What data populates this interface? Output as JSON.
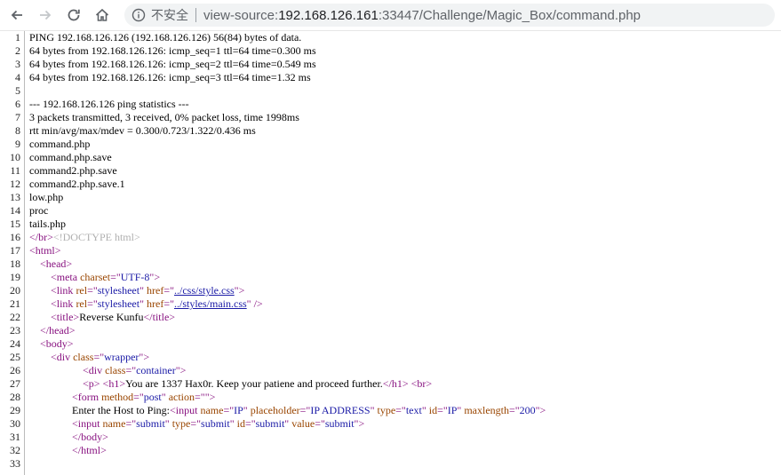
{
  "browser": {
    "security_label": "不安全",
    "url_scheme": "view-source:",
    "url_host": "192.168.126.161",
    "url_rest": ":33447/Challenge/Magic_Box/command.php"
  },
  "source_lines": [
    {
      "n": "1",
      "text": "PING 192.168.126.126 (192.168.126.126) 56(84) bytes of data."
    },
    {
      "n": "2",
      "text": "64 bytes from 192.168.126.126: icmp_seq=1 ttl=64 time=0.300 ms"
    },
    {
      "n": "3",
      "text": "64 bytes from 192.168.126.126: icmp_seq=2 ttl=64 time=0.549 ms"
    },
    {
      "n": "4",
      "text": "64 bytes from 192.168.126.126: icmp_seq=3 ttl=64 time=1.32 ms"
    },
    {
      "n": "5",
      "text": ""
    },
    {
      "n": "6",
      "text": "--- 192.168.126.126 ping statistics ---"
    },
    {
      "n": "7",
      "text": "3 packets transmitted, 3 received, 0% packet loss, time 1998ms"
    },
    {
      "n": "8",
      "text": "rtt min/avg/max/mdev = 0.300/0.723/1.322/0.436 ms"
    },
    {
      "n": "9",
      "text": "command.php"
    },
    {
      "n": "10",
      "text": "command.php.save"
    },
    {
      "n": "11",
      "text": "command2.php.save"
    },
    {
      "n": "12",
      "text": "command2.php.save.1"
    },
    {
      "n": "13",
      "text": "low.php"
    },
    {
      "n": "14",
      "text": "proc"
    },
    {
      "n": "15",
      "text": "tails.php"
    },
    {
      "n": "16",
      "a": "</br>",
      "b": "<!DOCTYPE html>"
    },
    {
      "n": "17",
      "a": "<html>"
    },
    {
      "n": "18",
      "indent": "    ",
      "a": "<head>"
    },
    {
      "n": "19",
      "indent": "        ",
      "a": "<meta ",
      "b": "charset",
      "c": "=\"",
      "d": "UTF-8",
      "e": "\">"
    },
    {
      "n": "20",
      "indent": "        ",
      "a": "<link ",
      "b": "rel",
      "c": "=\"",
      "d": "stylesheet",
      "e": "\" ",
      "f": "href",
      "g": "=\"",
      "h": "../css/style.css",
      "i": "\">"
    },
    {
      "n": "21",
      "indent": "        ",
      "a": "<link ",
      "b": "rel",
      "c": "=\"",
      "d": "stylesheet",
      "e": "\" ",
      "f": "href",
      "g": "=\"",
      "h": "../styles/main.css",
      "i": "\" />"
    },
    {
      "n": "22",
      "indent": "        ",
      "a": "<title>",
      "b": "Reverse Kunfu",
      "c": "</title>"
    },
    {
      "n": "23",
      "indent": "    ",
      "a": "</head>"
    },
    {
      "n": "24",
      "indent": "    ",
      "a": "<body>"
    },
    {
      "n": "25",
      "indent": "        ",
      "a": "<div ",
      "b": "class",
      "c": "=\"",
      "d": "wrapper",
      "e": "\">"
    },
    {
      "n": "26",
      "indent": "                    ",
      "a": "<div ",
      "b": "class",
      "c": "=\"",
      "d": "container",
      "e": "\">"
    },
    {
      "n": "27",
      "indent": "                    ",
      "a": "<p>",
      "b": " ",
      "c": "<h1>",
      "d": "You are 1337 Hax0r. Keep your patiene and proceed further.",
      "e": "</h1>",
      "f": " ",
      "g": "<br>"
    },
    {
      "n": "28",
      "indent": "                ",
      "a": "<form ",
      "b": "method",
      "c": "=\"",
      "d": "post",
      "e": "\" ",
      "f": "action",
      "g": "=\"",
      "h": "",
      "i": "\">"
    },
    {
      "n": "29",
      "indent": "                ",
      "pre": "Enter the Host to Ping:",
      "a": "<input ",
      "b": "name",
      "c": "=\"",
      "d": "IP",
      "e": "\" ",
      "f": "placeholder",
      "g": "=\"",
      "h": "IP ADDRESS",
      "i": "\" ",
      "j": "type",
      "k": "=\"",
      "l": "text",
      "m": "\" ",
      "o": "id",
      "p": "=\"",
      "q": "IP",
      "r": "\" ",
      "s": "maxlength",
      "t": "=\"",
      "u": "200",
      "v": "\">"
    },
    {
      "n": "30",
      "indent": "                ",
      "a": "<input ",
      "b": "name",
      "c": "=\"",
      "d": "submit",
      "e": "\" ",
      "f": "type",
      "g": "=\"",
      "h": "submit",
      "i": "\" ",
      "j": "id",
      "k": "=\"",
      "l": "submit",
      "m": "\" ",
      "o": "value",
      "p": "=\"",
      "q": "submit",
      "r": "\">"
    },
    {
      "n": "31",
      "indent": "                ",
      "a": "</body>"
    },
    {
      "n": "32",
      "indent": "                ",
      "a": "</html>"
    },
    {
      "n": "33",
      "text": ""
    }
  ]
}
